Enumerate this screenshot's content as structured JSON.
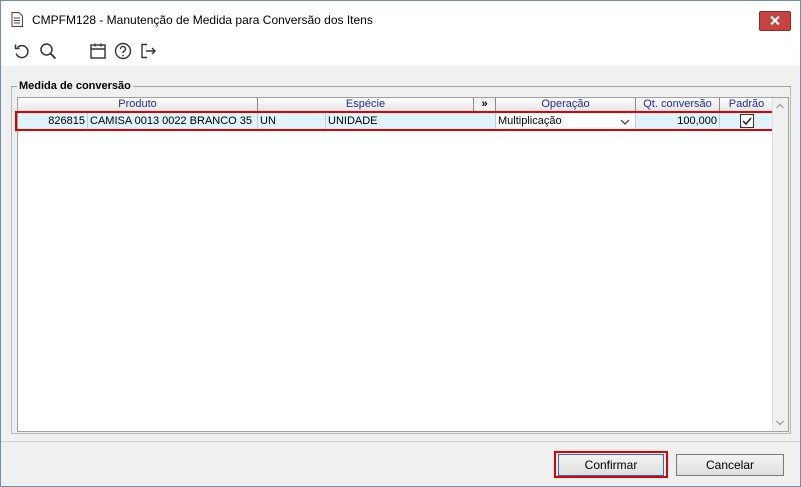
{
  "window": {
    "title": "CMPFM128 - Manutenção de Medida para Conversão dos Itens"
  },
  "toolbar": {
    "buttons": [
      {
        "name": "refresh-icon"
      },
      {
        "name": "search-icon"
      },
      {
        "name": "calendar-icon"
      },
      {
        "name": "help-icon"
      },
      {
        "name": "exit-icon"
      }
    ]
  },
  "group": {
    "label": "Medida de conversão"
  },
  "grid": {
    "headers": {
      "produto": "Produto",
      "especie": "Espécie",
      "expand": "»",
      "operacao": "Operação",
      "qt_conversao": "Qt. conversão",
      "padrao": "Padrão"
    },
    "rows": [
      {
        "code": "826815",
        "description": "CAMISA 0013 0022 BRANCO  35",
        "unit": "UN",
        "unit_name": "UNIDADE",
        "operation": "Multiplicação",
        "quantity": "100,000",
        "default_checked": true
      }
    ]
  },
  "footer": {
    "confirm_label": "Confirmar",
    "cancel_label": "Cancelar"
  },
  "colors": {
    "highlight": "#e00000",
    "row_selected": "#dff3fb",
    "header_text": "#1c2ea5",
    "close_button": "#c7433f"
  }
}
